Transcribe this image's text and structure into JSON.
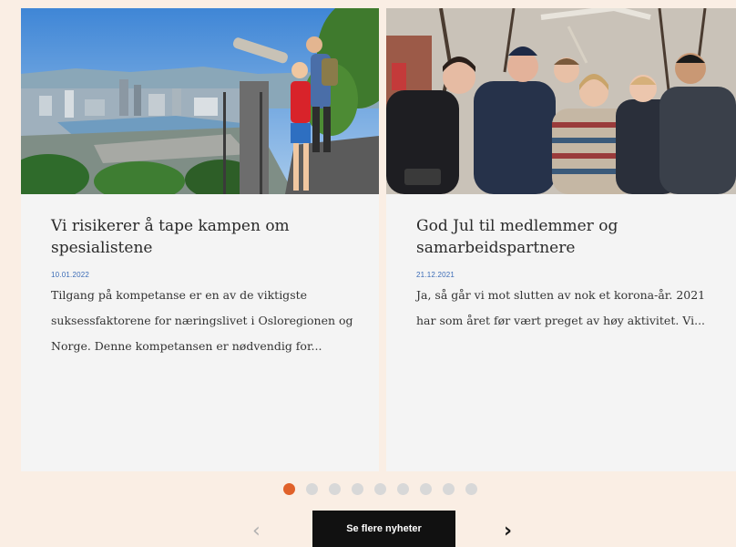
{
  "articles": [
    {
      "title": "Vi risikerer å tape kampen om spesialistene",
      "date": "10.01.2022",
      "excerpt": "Tilgang på kompetanse er en av de viktigste suksessfaktorene for næringslivet i Osloregionen og Norge. Denne kompetansen er  nødvendig for...",
      "image": "Oslo city view with child at binocular viewer"
    },
    {
      "title": "God Jul til medlemmer og samarbeidspartnere",
      "date": "21.12.2021",
      "excerpt": "Ja, så går vi mot slutten av nok et korona-år. 2021 har som året før vært preget av høy aktivitet. Vi...",
      "image": "Group of six people smiling outdoors in winter"
    }
  ],
  "carousel": {
    "dot_count": 9,
    "active_index": 0,
    "prev_icon": "chevron-left-icon",
    "next_icon": "chevron-right-icon"
  },
  "more_button_label": "Se flere nyheter",
  "colors": {
    "background": "#faeee4",
    "card": "#f4f4f4",
    "accent": "#e0612a",
    "date": "#3b6bb6",
    "button": "#111111"
  }
}
